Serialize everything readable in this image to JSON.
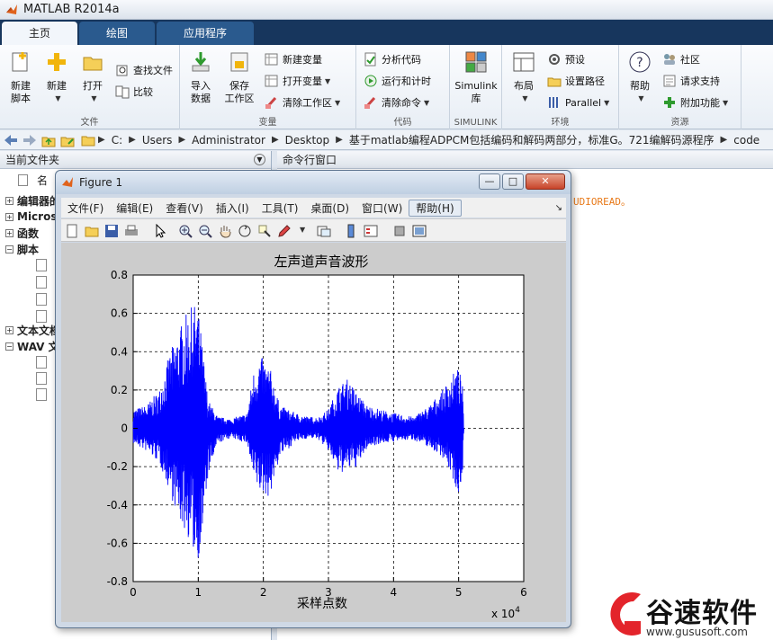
{
  "window": {
    "title": "MATLAB R2014a"
  },
  "tabs": [
    {
      "label": "主页",
      "active": true
    },
    {
      "label": "绘图",
      "active": false
    },
    {
      "label": "应用程序",
      "active": false
    }
  ],
  "ribbon": {
    "file": {
      "title": "文件",
      "new_script": [
        "新建",
        "脚本"
      ],
      "new": "新建",
      "open": "打开",
      "find_files": "查找文件",
      "compare": "比较"
    },
    "variable": {
      "title": "变量",
      "import_data": [
        "导入",
        "数据"
      ],
      "save_workspace": [
        "保存",
        "工作区"
      ],
      "new_variable": "新建变量",
      "open_variable": "打开变量",
      "clear_workspace": "清除工作区"
    },
    "code": {
      "title": "代码",
      "analyze_code": "分析代码",
      "run_and_time": "运行和计时",
      "clear_commands": "清除命令"
    },
    "simulink": {
      "title": "SIMULINK",
      "label": [
        "Simulink",
        "库"
      ]
    },
    "environment": {
      "title": "环境",
      "layout": "布局",
      "preferences": "预设",
      "set_path": "设置路径",
      "parallel": "Parallel"
    },
    "resources": {
      "title": "资源",
      "help": "帮助",
      "community": "社区",
      "request_support": "请求支持",
      "add_ons": "附加功能"
    }
  },
  "address": {
    "crumbs": [
      "C:",
      "Users",
      "Administrator",
      "Desktop",
      "基于matlab编程ADPCM包括编码和解码两部分，标准G。721编解码源程序",
      "code"
    ]
  },
  "current_folder": {
    "title": "当前文件夹",
    "name_col": "名",
    "tree": [
      {
        "label": "编辑器的",
        "expanded": false
      },
      {
        "label": "Micros",
        "expanded": false
      },
      {
        "label": "函数",
        "expanded": false
      },
      {
        "label": "脚本",
        "expanded": true
      },
      {
        "label": "文本文档",
        "expanded": false
      },
      {
        "label": "WAV 文",
        "expanded": true
      }
    ]
  },
  "command_window": {
    "title": "命令行窗口",
    "warning_fragment": "UDIOREAD。"
  },
  "figure": {
    "title": "Figure 1",
    "menus": [
      "文件(F)",
      "编辑(E)",
      "查看(V)",
      "插入(I)",
      "工具(T)",
      "桌面(D)",
      "窗口(W)",
      "帮助(H)"
    ],
    "buttons": {
      "minimize": "—",
      "maximize": "□",
      "close": "✕"
    }
  },
  "chart_data": {
    "type": "line",
    "title": "左声道声音波形",
    "xlabel": "采样点数",
    "ylabel": "",
    "x_multiplier": "x 10",
    "x_multiplier_exp": "4",
    "xlim": [
      0,
      6
    ],
    "ylim": [
      -0.8,
      0.8
    ],
    "xticks": [
      0,
      1,
      2,
      3,
      4,
      5,
      6
    ],
    "yticks": [
      -0.8,
      -0.6,
      -0.4,
      -0.2,
      0,
      0.2,
      0.4,
      0.6,
      0.8
    ],
    "grid": true,
    "series": [
      {
        "color": "#0000ff",
        "envelope": [
          {
            "x": 0.0,
            "max": 0.1,
            "min": -0.08
          },
          {
            "x": 0.2,
            "max": 0.12,
            "min": -0.12
          },
          {
            "x": 0.4,
            "max": 0.2,
            "min": -0.18
          },
          {
            "x": 0.55,
            "max": 0.38,
            "min": -0.32
          },
          {
            "x": 0.7,
            "max": 0.52,
            "min": -0.48
          },
          {
            "x": 0.85,
            "max": 0.62,
            "min": -0.58
          },
          {
            "x": 0.98,
            "max": 0.66,
            "min": -0.7
          },
          {
            "x": 1.05,
            "max": 0.48,
            "min": -0.62
          },
          {
            "x": 1.15,
            "max": 0.15,
            "min": -0.25
          },
          {
            "x": 1.3,
            "max": 0.06,
            "min": -0.08
          },
          {
            "x": 1.5,
            "max": 0.05,
            "min": -0.05
          },
          {
            "x": 1.75,
            "max": 0.08,
            "min": -0.08
          },
          {
            "x": 1.85,
            "max": 0.3,
            "min": -0.28
          },
          {
            "x": 1.95,
            "max": 0.38,
            "min": -0.34
          },
          {
            "x": 2.1,
            "max": 0.32,
            "min": -0.36
          },
          {
            "x": 2.25,
            "max": 0.12,
            "min": -0.15
          },
          {
            "x": 2.5,
            "max": 0.08,
            "min": -0.07
          },
          {
            "x": 2.7,
            "max": 0.06,
            "min": -0.05
          },
          {
            "x": 2.85,
            "max": 0.06,
            "min": -0.06
          },
          {
            "x": 3.0,
            "max": 0.1,
            "min": -0.12
          },
          {
            "x": 3.15,
            "max": 0.22,
            "min": -0.24
          },
          {
            "x": 3.3,
            "max": 0.26,
            "min": -0.22
          },
          {
            "x": 3.45,
            "max": 0.18,
            "min": -0.2
          },
          {
            "x": 3.6,
            "max": 0.12,
            "min": -0.1
          },
          {
            "x": 3.8,
            "max": 0.1,
            "min": -0.08
          },
          {
            "x": 4.0,
            "max": 0.08,
            "min": -0.07
          },
          {
            "x": 4.3,
            "max": 0.06,
            "min": -0.06
          },
          {
            "x": 4.55,
            "max": 0.12,
            "min": -0.1
          },
          {
            "x": 4.75,
            "max": 0.2,
            "min": -0.15
          },
          {
            "x": 4.9,
            "max": 0.28,
            "min": -0.25
          },
          {
            "x": 5.0,
            "max": 0.32,
            "min": -0.36
          },
          {
            "x": 5.06,
            "max": 0.22,
            "min": -0.24
          },
          {
            "x": 5.08,
            "max": 0.0,
            "min": 0.0
          }
        ]
      }
    ]
  },
  "watermark": {
    "text": "谷速软件",
    "url": "www.gususoft.com"
  },
  "colors": {
    "ribbon_tab_bg": "#17365d",
    "plot_line": "#0000ff",
    "warning": "#e87a1a"
  }
}
